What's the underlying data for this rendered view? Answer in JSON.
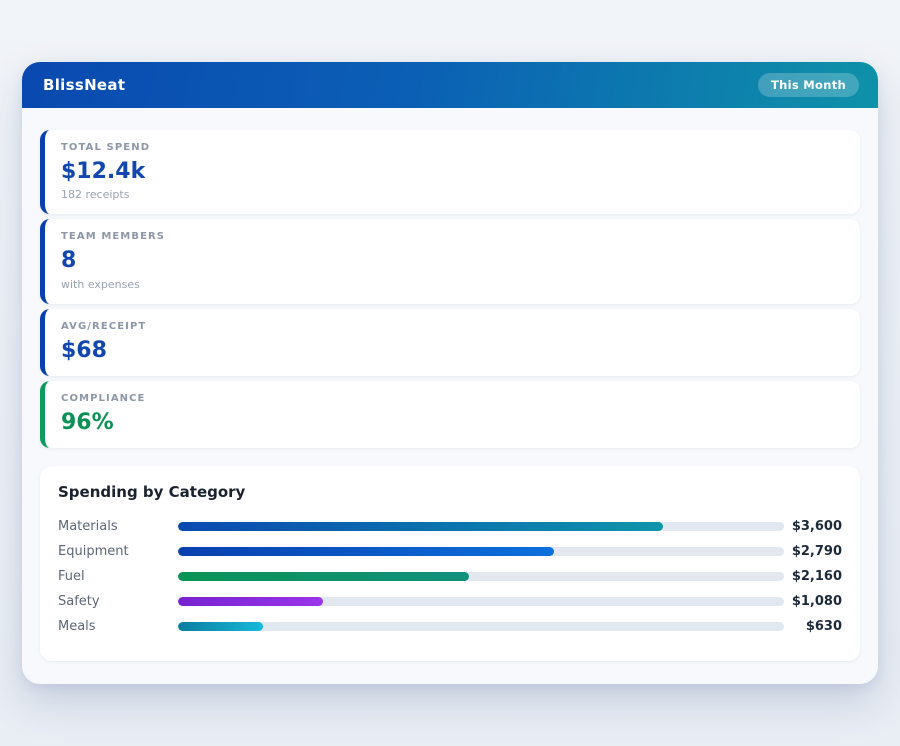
{
  "app": {
    "title": "BlissNeat",
    "period_badge": "This Month"
  },
  "theme": {
    "header_gradient_start": "#0a49b0",
    "header_gradient_end": "#0e92a8",
    "stat_blue": "#1147ae",
    "stat_green": "#0b9156",
    "track_color": "#e2e8ef"
  },
  "stats": [
    {
      "label": "TOTAL SPEND",
      "value": "$12.4k",
      "sub": "182 receipts",
      "accent": "#1147ae",
      "border": "#0a3fae"
    },
    {
      "label": "TEAM MEMBERS",
      "value": "8",
      "sub": "with expenses",
      "accent": "#1147ae",
      "border": "#0a3fae"
    },
    {
      "label": "AVG/RECEIPT",
      "value": "$68",
      "sub": "",
      "accent": "#1147ae",
      "border": "#0a3fae"
    },
    {
      "label": "COMPLIANCE",
      "value": "96%",
      "sub": "",
      "accent": "#0b9156",
      "border": "#0f9b5e"
    }
  ],
  "chart_data": {
    "type": "bar",
    "orientation": "horizontal",
    "title": "Spending by Category",
    "categories": [
      "Materials",
      "Equipment",
      "Fuel",
      "Safety",
      "Meals"
    ],
    "values": [
      3600,
      2790,
      2160,
      1080,
      630
    ],
    "value_labels": [
      "$3,600",
      "$2,790",
      "$2,160",
      "$1,080",
      "$630"
    ],
    "xlim": [
      0,
      4500
    ],
    "grid": false,
    "legend": "none",
    "bar_gradients": [
      [
        "#0a49b0",
        "#0e95aa"
      ],
      [
        "#0a3fae",
        "#0b70dd"
      ],
      [
        "#0a9355",
        "#12907e"
      ],
      [
        "#7622cf",
        "#9a35ea"
      ],
      [
        "#0c7d9e",
        "#16b9d9"
      ]
    ]
  }
}
